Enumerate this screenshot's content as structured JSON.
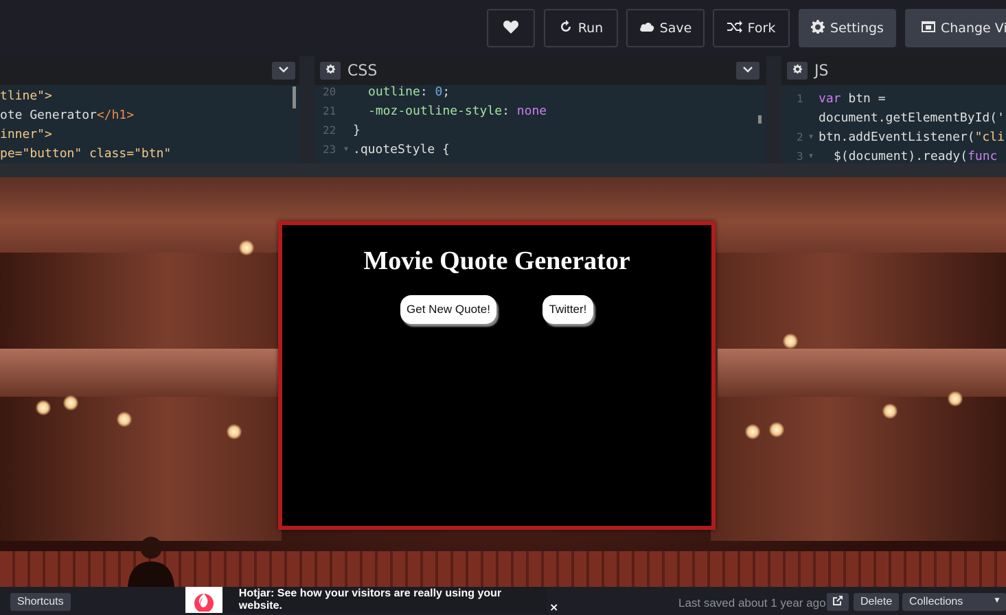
{
  "header": {
    "heart_label": "",
    "run_label": "Run",
    "save_label": "Save",
    "fork_label": "Fork",
    "settings_label": "Settings",
    "change_view_label": "Change View"
  },
  "html_pane": {
    "lines": [
      {
        "a": "tline\">",
        "t": "tag"
      },
      {
        "a": "ote Generator",
        "b": "</h1>"
      },
      {
        "a": "inner\">"
      },
      {
        "a": "pe=\"button\" class=\"btn\""
      }
    ]
  },
  "css_pane": {
    "title": "CSS",
    "line_numbers": [
      "20",
      "21",
      "22",
      "23"
    ],
    "l1_prop": "outline",
    "l1_sep": ": ",
    "l1_val": "0",
    "l1_end": ";",
    "l2_prop": "-moz-outline-style",
    "l2_sep": ": ",
    "l2_val": "none",
    "l3": "}",
    "l4": ".quoteStyle {"
  },
  "js_pane": {
    "title": "JS",
    "line_numbers": [
      "1",
      "",
      "2",
      "3"
    ],
    "l1_kw": "var",
    "l1_rest": " btn =",
    "l2": "document.getElementById('",
    "l3a": "btn.addEventListener(",
    "l3b": "\"cli",
    "l4a": "$(document).ready(",
    "l4b": "func"
  },
  "preview": {
    "title": "Movie Quote Generator",
    "new_quote_label": "Get New Quote!",
    "twitter_label": "Twitter!",
    "frame_color": "#b01c1c"
  },
  "footer": {
    "shortcuts_label": "Shortcuts",
    "hotjar_text": "Hotjar: See how your visitors are really using your website.",
    "close_label": "×",
    "saved_text": "Last saved about 1 year ago",
    "delete_label": "Delete",
    "collections_label": "Collections"
  }
}
